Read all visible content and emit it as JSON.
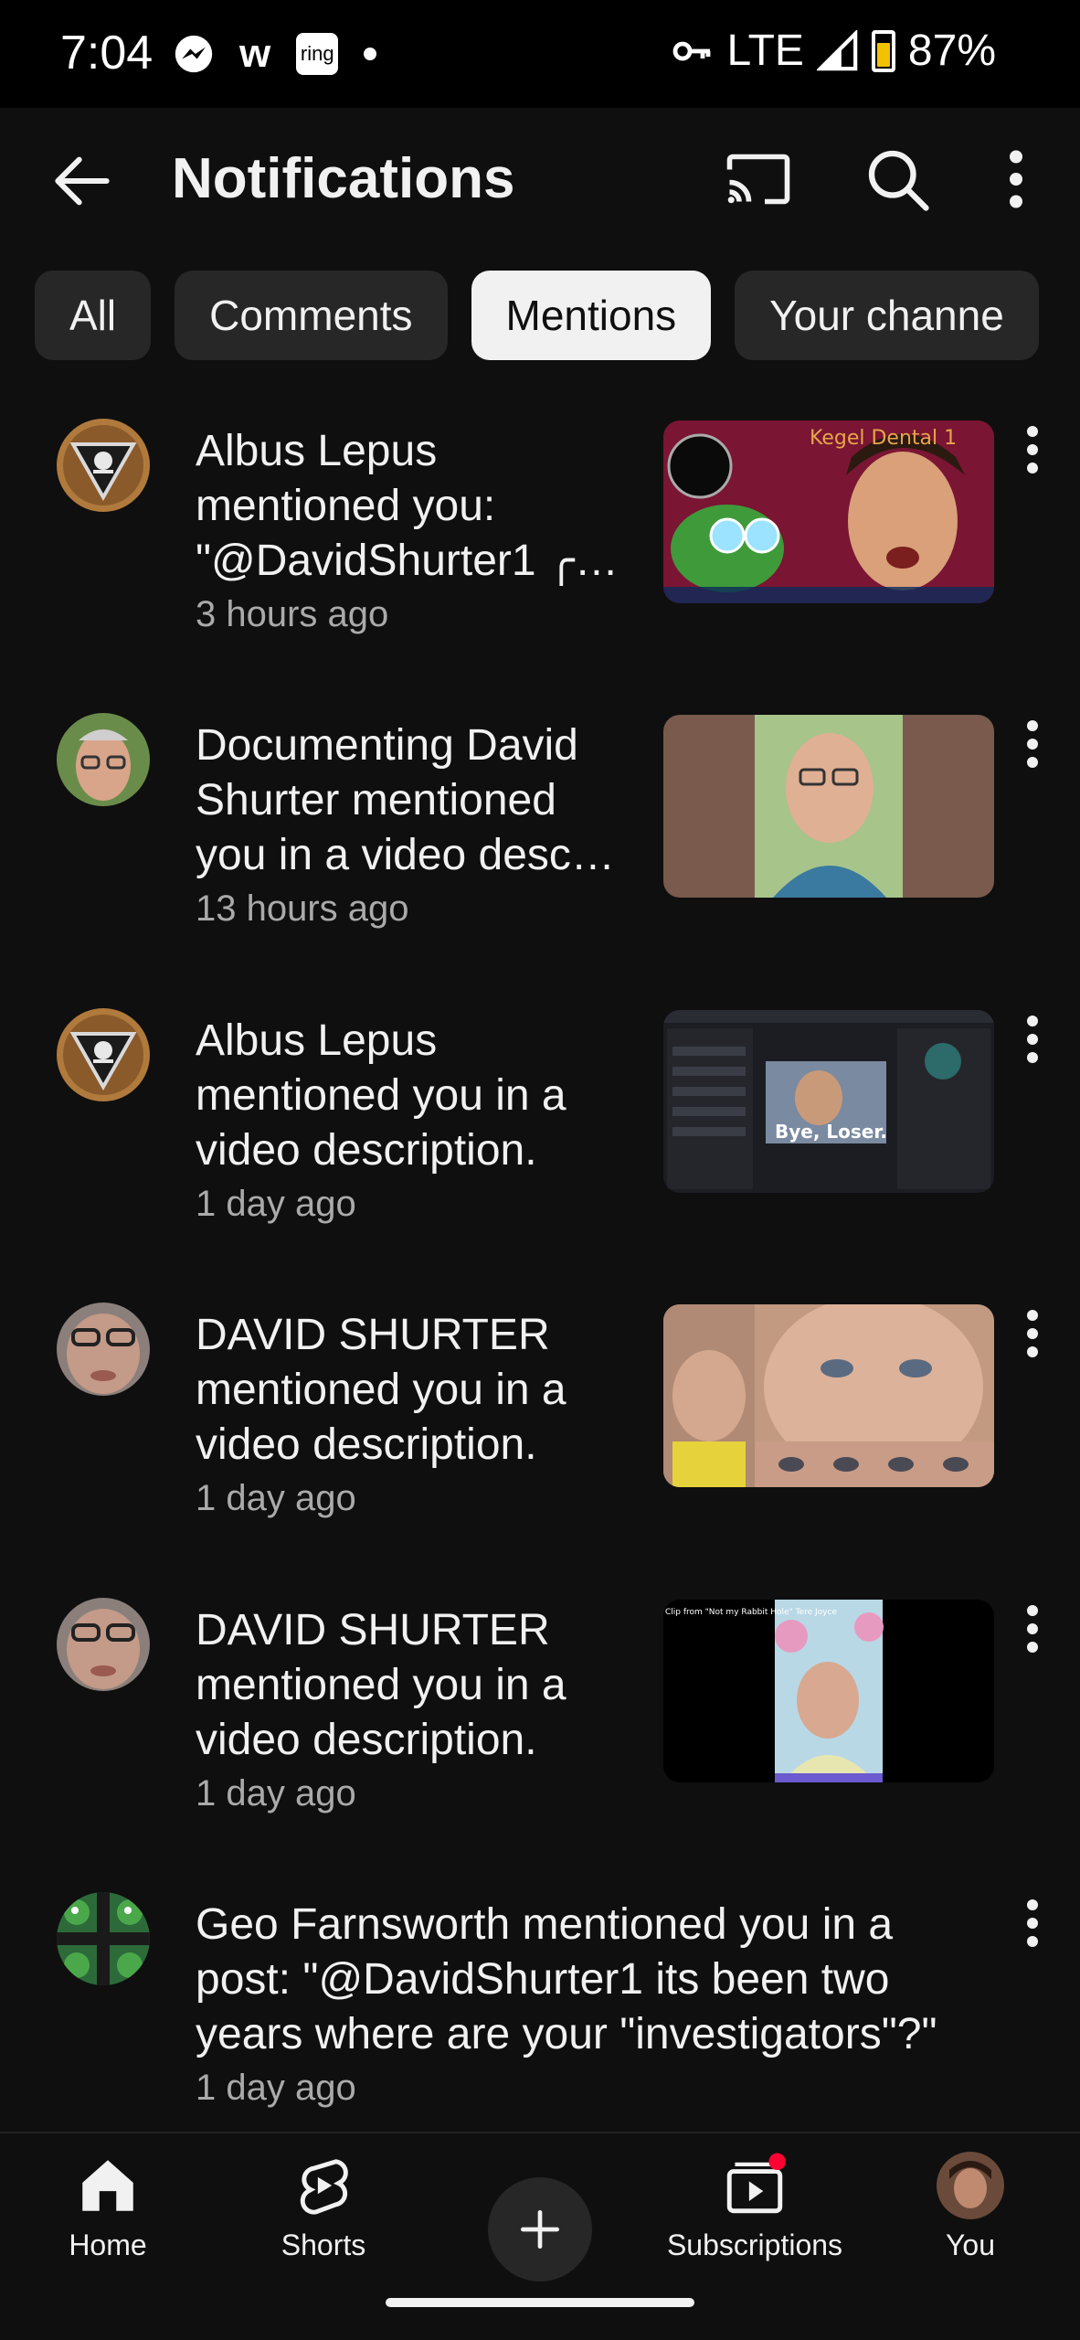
{
  "status_bar": {
    "time": "7:04",
    "w_label": "w",
    "ring_label": "ring",
    "network": "LTE",
    "battery": "87%"
  },
  "header": {
    "title": "Notifications",
    "icons": [
      "back-arrow-icon",
      "cast-icon",
      "search-icon",
      "more-vert-icon"
    ]
  },
  "chips": [
    {
      "label": "All",
      "active": false
    },
    {
      "label": "Comments",
      "active": false
    },
    {
      "label": "Mentions",
      "active": true
    },
    {
      "label": "Your channe",
      "active": false
    }
  ],
  "notifications": [
    {
      "text": "Albus Lepus mentioned you: \"@DavidShurter1 ╭…",
      "time": "3 hours ago",
      "avatar": "triangle-skull-avatar",
      "thumb_text": "Kegel Dental 1"
    },
    {
      "text": "Documenting David Shurter mentioned you in a video desc…",
      "time": "13 hours ago",
      "avatar": "man-glasses-avatar"
    },
    {
      "text": "Albus Lepus mentioned you in a video description.",
      "time": "1 day ago",
      "avatar": "triangle-skull-avatar",
      "thumb_text": "Bye, Loser."
    },
    {
      "text": "DAVID SHURTER mentioned you in a video description.",
      "time": "1 day ago",
      "avatar": "man-face-avatar"
    },
    {
      "text": "DAVID SHURTER mentioned you in a video description.",
      "time": "1 day ago",
      "avatar": "man-face-avatar",
      "thumb_text": "Clip from \"Not my Rabbit Hole\" Tere Joyce"
    },
    {
      "text": "Geo Farnsworth mentioned you in a post: \"@DavidShurter1 its been two years where are your \"investigators\"?\"",
      "time": "1 day ago",
      "avatar": "frog-avatar"
    }
  ],
  "bottom_nav": {
    "home": "Home",
    "shorts": "Shorts",
    "subscriptions": "Subscriptions",
    "you": "You"
  },
  "colors": {
    "background": "#0f0f0f",
    "chip": "#272727",
    "chip_active": "#f1f1f1",
    "secondary_text": "#aaaaaa",
    "notification_dot": "#ff0033"
  }
}
